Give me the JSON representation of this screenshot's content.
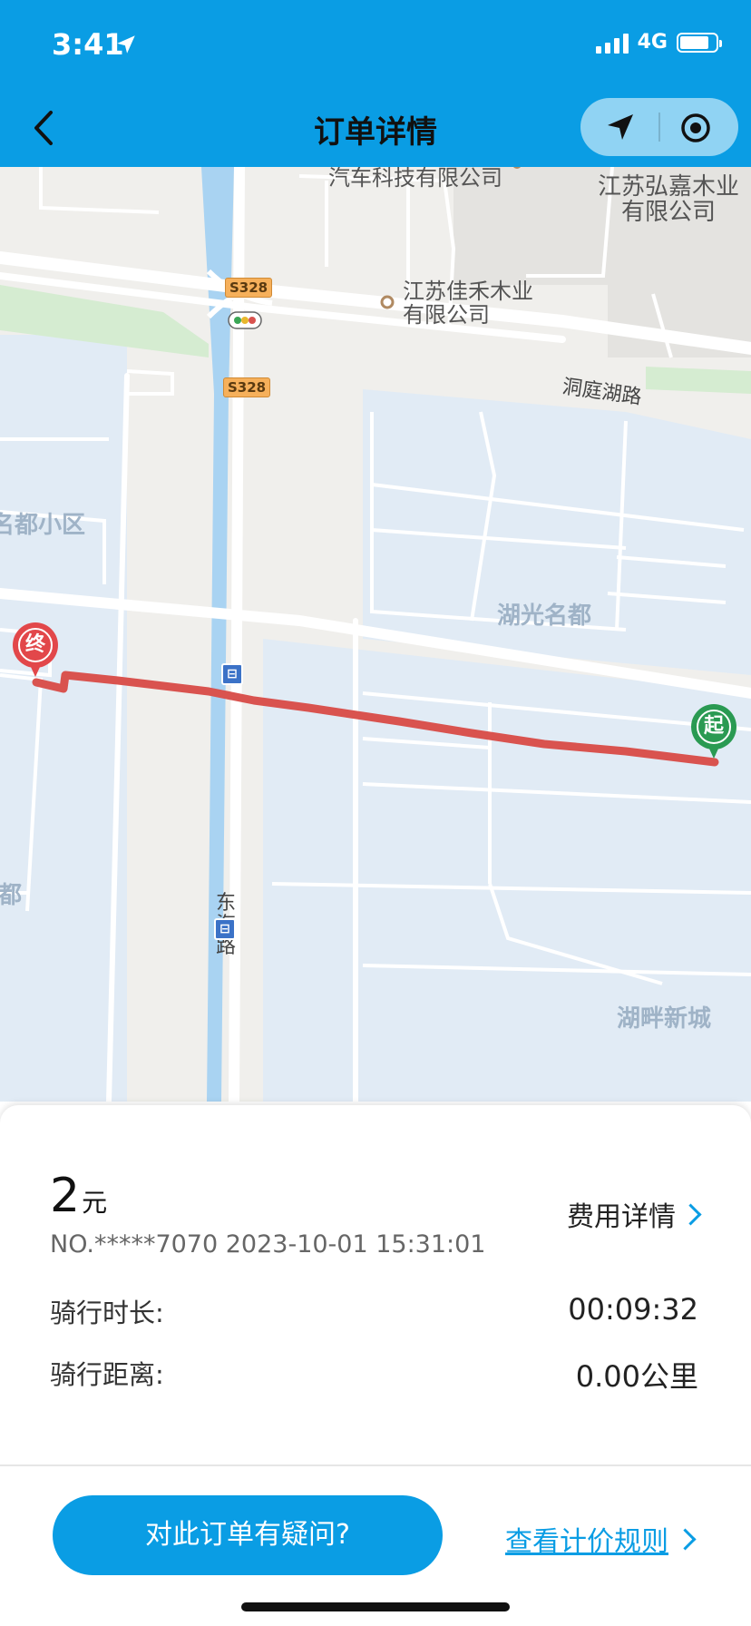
{
  "status_bar": {
    "time": "3:41",
    "network": "4G"
  },
  "header": {
    "title": "订单详情"
  },
  "map": {
    "pois": [
      {
        "text": "汽车科技有限公司"
      },
      {
        "text": "江苏弘嘉木业有限公司"
      },
      {
        "text": "江苏佳禾木业有限公司"
      }
    ],
    "districts": [
      "名都小区",
      "湖光名都",
      "名都",
      "湖畔新城"
    ],
    "roads": [
      "洞庭湖路",
      "东海路"
    ],
    "shields": [
      "S328",
      "S328"
    ],
    "markers": {
      "end": "终",
      "start": "起"
    }
  },
  "order": {
    "price": "2",
    "unit": "元",
    "fee_detail": "费用详情",
    "order_no": "NO.*****7070 2023-10-01 15:31:01",
    "duration_label": "骑行时长:",
    "duration_value": "00:09:32",
    "distance_label": "骑行距离:",
    "distance_value": "0.00公里"
  },
  "actions": {
    "question_label": "对此订单有疑问?",
    "rule_label": "查看计价规则"
  },
  "colors": {
    "accent": "#0a9de4",
    "route": "#d9534f",
    "end_marker": "#e2474a",
    "start_marker": "#2a9a52"
  }
}
